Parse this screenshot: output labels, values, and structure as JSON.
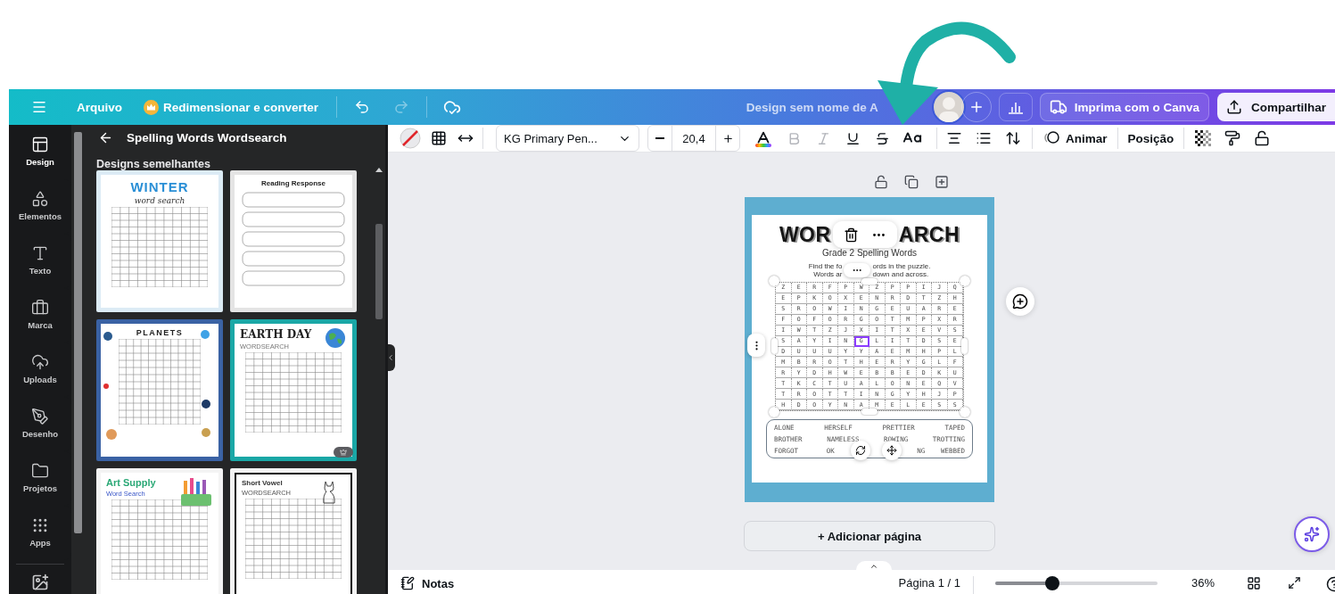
{
  "top_bar": {
    "file_menu": "Arquivo",
    "resize_button": "Redimensionar e converter",
    "undo": {
      "disabled": false
    },
    "redo": {
      "disabled": true
    },
    "design_title": "Design sem nome de A",
    "print_button": "Imprima com o Canva",
    "share_button": "Compartilhar"
  },
  "sidebar": {
    "items": [
      {
        "label": "Design",
        "selected": true
      },
      {
        "label": "Elementos",
        "selected": false
      },
      {
        "label": "Texto",
        "selected": false
      },
      {
        "label": "Marca",
        "selected": false
      },
      {
        "label": "Uploads",
        "selected": false
      },
      {
        "label": "Desenho",
        "selected": false
      },
      {
        "label": "Projetos",
        "selected": false
      },
      {
        "label": "Apps",
        "selected": false
      }
    ]
  },
  "panel": {
    "title": "Spelling Words Wordsearch",
    "section": "Designs semelhantes",
    "templates": [
      {
        "kind": "wordsearch",
        "title": "WINTER",
        "subtitle": "word search",
        "color": "#dcebf5",
        "badge": false
      },
      {
        "kind": "form",
        "title": "Reading Response",
        "color": "#e4e4e4",
        "badge": false
      },
      {
        "kind": "wordsearch",
        "title": "PLANETS",
        "color": "#3a62a4",
        "badge": false
      },
      {
        "kind": "wordsearch",
        "title": "EARTH DAY",
        "subtitle": "WORDSEARCH",
        "color": "#1aa7a6",
        "badge": true
      },
      {
        "kind": "wordsearch",
        "title": "Art Supply",
        "subtitle": "Word Search",
        "color": "#f4f4f4",
        "badge": false
      },
      {
        "kind": "wordsearch",
        "title": "Short Vowel",
        "subtitle": "WORDSEARCH",
        "color": "#f4f4f4",
        "badge": false
      }
    ]
  },
  "toolbar": {
    "font": "KG Primary Pen...",
    "font_size": "20,4",
    "format_buttons": [
      {
        "kind": "color",
        "disabled": false
      },
      {
        "kind": "bold",
        "disabled": true
      },
      {
        "kind": "italic",
        "disabled": true
      },
      {
        "kind": "underline",
        "disabled": false
      },
      {
        "kind": "strike",
        "disabled": false
      },
      {
        "kind": "case",
        "disabled": false
      }
    ],
    "animate": "Animar",
    "position": "Posição"
  },
  "page": {
    "title_left": "WOR",
    "title_right": "ARCH",
    "subtitle": "Grade 2 Spelling Words",
    "instructions": [
      {
        "left": "Find the fo",
        "right": "ords in the puzzle."
      },
      {
        "left": "Words ar",
        "right": "down and across."
      }
    ],
    "grid": [
      [
        {
          "t": "Z",
          "selected": false
        },
        {
          "t": "E",
          "selected": false
        },
        {
          "t": "R",
          "selected": false
        },
        {
          "t": "F",
          "selected": false
        },
        {
          "t": "P",
          "selected": false
        },
        {
          "t": "W",
          "selected": false
        },
        {
          "t": "Z",
          "selected": false
        },
        {
          "t": "P",
          "selected": false
        },
        {
          "t": "P",
          "selected": false
        },
        {
          "t": "I",
          "selected": false
        },
        {
          "t": "J",
          "selected": false
        },
        {
          "t": "Q",
          "selected": false
        }
      ],
      [
        {
          "t": "E",
          "selected": false
        },
        {
          "t": "P",
          "selected": false
        },
        {
          "t": "K",
          "selected": false
        },
        {
          "t": "O",
          "selected": false
        },
        {
          "t": "X",
          "selected": false
        },
        {
          "t": "E",
          "selected": false
        },
        {
          "t": "N",
          "selected": false
        },
        {
          "t": "R",
          "selected": false
        },
        {
          "t": "D",
          "selected": false
        },
        {
          "t": "T",
          "selected": false
        },
        {
          "t": "Z",
          "selected": false
        },
        {
          "t": "H",
          "selected": false
        }
      ],
      [
        {
          "t": "S",
          "selected": false
        },
        {
          "t": "R",
          "selected": false
        },
        {
          "t": "O",
          "selected": false
        },
        {
          "t": "W",
          "selected": false
        },
        {
          "t": "I",
          "selected": false
        },
        {
          "t": "N",
          "selected": false
        },
        {
          "t": "G",
          "selected": false
        },
        {
          "t": "E",
          "selected": false
        },
        {
          "t": "U",
          "selected": false
        },
        {
          "t": "A",
          "selected": false
        },
        {
          "t": "R",
          "selected": false
        },
        {
          "t": "E",
          "selected": false
        }
      ],
      [
        {
          "t": "F",
          "selected": false
        },
        {
          "t": "O",
          "selected": false
        },
        {
          "t": "F",
          "selected": false
        },
        {
          "t": "O",
          "selected": false
        },
        {
          "t": "R",
          "selected": false
        },
        {
          "t": "G",
          "selected": false
        },
        {
          "t": "O",
          "selected": false
        },
        {
          "t": "T",
          "selected": false
        },
        {
          "t": "M",
          "selected": false
        },
        {
          "t": "P",
          "selected": false
        },
        {
          "t": "X",
          "selected": false
        },
        {
          "t": "R",
          "selected": false
        }
      ],
      [
        {
          "t": "I",
          "selected": false
        },
        {
          "t": "W",
          "selected": false
        },
        {
          "t": "T",
          "selected": false
        },
        {
          "t": "Z",
          "selected": false
        },
        {
          "t": "J",
          "selected": false
        },
        {
          "t": "X",
          "selected": false
        },
        {
          "t": "I",
          "selected": false
        },
        {
          "t": "T",
          "selected": false
        },
        {
          "t": "X",
          "selected": false
        },
        {
          "t": "E",
          "selected": false
        },
        {
          "t": "V",
          "selected": false
        },
        {
          "t": "S",
          "selected": false
        }
      ],
      [
        {
          "t": "S",
          "selected": false
        },
        {
          "t": "A",
          "selected": false
        },
        {
          "t": "Y",
          "selected": false
        },
        {
          "t": "I",
          "selected": false
        },
        {
          "t": "N",
          "selected": false
        },
        {
          "t": "G",
          "selected": true
        },
        {
          "t": "L",
          "selected": false
        },
        {
          "t": "I",
          "selected": false
        },
        {
          "t": "T",
          "selected": false
        },
        {
          "t": "D",
          "selected": false
        },
        {
          "t": "S",
          "selected": false
        },
        {
          "t": "E",
          "selected": false
        }
      ],
      [
        {
          "t": "D",
          "selected": false
        },
        {
          "t": "U",
          "selected": false
        },
        {
          "t": "U",
          "selected": false
        },
        {
          "t": "U",
          "selected": false
        },
        {
          "t": "Y",
          "selected": false
        },
        {
          "t": "Y",
          "selected": false
        },
        {
          "t": "A",
          "selected": false
        },
        {
          "t": "E",
          "selected": false
        },
        {
          "t": "M",
          "selected": false
        },
        {
          "t": "H",
          "selected": false
        },
        {
          "t": "P",
          "selected": false
        },
        {
          "t": "L",
          "selected": false
        }
      ],
      [
        {
          "t": "M",
          "selected": false
        },
        {
          "t": "B",
          "selected": false
        },
        {
          "t": "R",
          "selected": false
        },
        {
          "t": "O",
          "selected": false
        },
        {
          "t": "T",
          "selected": false
        },
        {
          "t": "H",
          "selected": false
        },
        {
          "t": "E",
          "selected": false
        },
        {
          "t": "R",
          "selected": false
        },
        {
          "t": "Y",
          "selected": false
        },
        {
          "t": "G",
          "selected": false
        },
        {
          "t": "L",
          "selected": false
        },
        {
          "t": "F",
          "selected": false
        }
      ],
      [
        {
          "t": "R",
          "selected": false
        },
        {
          "t": "Y",
          "selected": false
        },
        {
          "t": "D",
          "selected": false
        },
        {
          "t": "H",
          "selected": false
        },
        {
          "t": "W",
          "selected": false
        },
        {
          "t": "E",
          "selected": false
        },
        {
          "t": "B",
          "selected": false
        },
        {
          "t": "B",
          "selected": false
        },
        {
          "t": "E",
          "selected": false
        },
        {
          "t": "D",
          "selected": false
        },
        {
          "t": "K",
          "selected": false
        },
        {
          "t": "U",
          "selected": false
        }
      ],
      [
        {
          "t": "T",
          "selected": false
        },
        {
          "t": "K",
          "selected": false
        },
        {
          "t": "C",
          "selected": false
        },
        {
          "t": "T",
          "selected": false
        },
        {
          "t": "U",
          "selected": false
        },
        {
          "t": "A",
          "selected": false
        },
        {
          "t": "L",
          "selected": false
        },
        {
          "t": "O",
          "selected": false
        },
        {
          "t": "N",
          "selected": false
        },
        {
          "t": "E",
          "selected": false
        },
        {
          "t": "Q",
          "selected": false
        },
        {
          "t": "V",
          "selected": false
        }
      ],
      [
        {
          "t": "T",
          "selected": false
        },
        {
          "t": "R",
          "selected": false
        },
        {
          "t": "O",
          "selected": false
        },
        {
          "t": "T",
          "selected": false
        },
        {
          "t": "T",
          "selected": false
        },
        {
          "t": "I",
          "selected": false
        },
        {
          "t": "N",
          "selected": false
        },
        {
          "t": "G",
          "selected": false
        },
        {
          "t": "Y",
          "selected": false
        },
        {
          "t": "H",
          "selected": false
        },
        {
          "t": "J",
          "selected": false
        },
        {
          "t": "P",
          "selected": false
        }
      ],
      [
        {
          "t": "H",
          "selected": false
        },
        {
          "t": "D",
          "selected": false
        },
        {
          "t": "O",
          "selected": false
        },
        {
          "t": "Y",
          "selected": false
        },
        {
          "t": "N",
          "selected": false
        },
        {
          "t": "A",
          "selected": false
        },
        {
          "t": "M",
          "selected": false
        },
        {
          "t": "E",
          "selected": false
        },
        {
          "t": "L",
          "selected": false
        },
        {
          "t": "E",
          "selected": false
        },
        {
          "t": "S",
          "selected": false
        },
        {
          "t": "S",
          "selected": false
        }
      ]
    ],
    "word_bank": [
      [
        "ALONE",
        "HERSELF",
        "PRETTIER",
        "TAPED"
      ],
      [
        "BROTHER",
        "NAMELESS",
        "ROWING",
        "TROTTING"
      ],
      [
        "FORGOT",
        "OK",
        "NG",
        "WEBBED"
      ]
    ]
  },
  "add_page": "+ Adicionar página",
  "bottom_bar": {
    "notes": "Notas",
    "page_indicator": "Página 1 / 1",
    "zoom": {
      "level": 0.35
    },
    "zoom_reading": "36%"
  }
}
